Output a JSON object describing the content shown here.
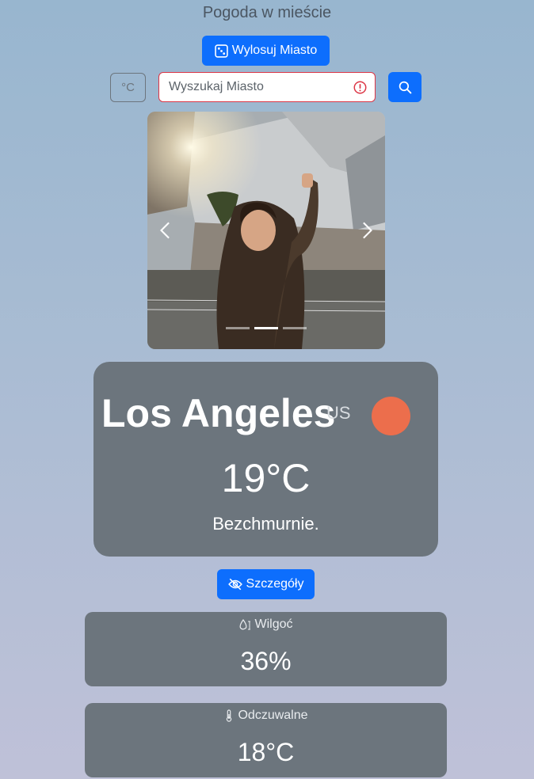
{
  "header": {
    "title": "Pogoda w mieście"
  },
  "controls": {
    "random_city_label": "Wylosuj Miasto",
    "unit_label": "°C",
    "search_placeholder": "Wyszukaj Miasto"
  },
  "carousel": {
    "slide_count": 3,
    "active_index": 1
  },
  "weather": {
    "city": "Los Angeles",
    "country": "US",
    "temperature": "19°C",
    "description": "Bezchmurnie."
  },
  "details_button": {
    "label": "Szczegóły"
  },
  "details": {
    "humidity": {
      "label": "Wilgoć",
      "value": "36%",
      "icon": "humidity-icon"
    },
    "feels_like": {
      "label": "Odczuwalne",
      "value": "18°C",
      "icon": "thermometer-icon"
    }
  },
  "colors": {
    "primary": "#0d6efd",
    "card": "#6c757d",
    "sun": "#ec6e4c",
    "invalid": "#dc3545"
  }
}
